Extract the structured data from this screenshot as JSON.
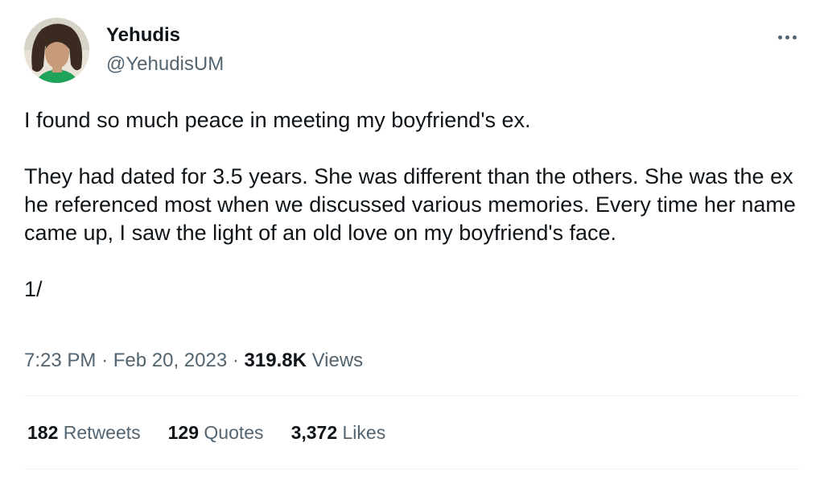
{
  "author": {
    "name": "Yehudis",
    "handle": "@YehudisUM",
    "avatar_icon": "profile-photo"
  },
  "more_icon": "more-options-icon",
  "tweet": {
    "paragraphs": [
      "I found so much peace in meeting my boyfriend's ex.",
      "They had dated for 3.5 years. She was different than the others. She was the ex he referenced most when we discussed various memories. Every time her name came up, I saw the light of an old love on my boyfriend's face.",
      "1/"
    ]
  },
  "meta": {
    "time": "7:23 PM",
    "separator": "·",
    "date": "Feb 20, 2023",
    "views_count": "319.8K",
    "views_label": "Views"
  },
  "stats": {
    "retweets_count": "182",
    "retweets_label": "Retweets",
    "quotes_count": "129",
    "quotes_label": "Quotes",
    "likes_count": "3,372",
    "likes_label": "Likes"
  },
  "colors": {
    "primary_text": "#0f1419",
    "secondary_text": "#536471",
    "divider": "#eff3f4"
  }
}
